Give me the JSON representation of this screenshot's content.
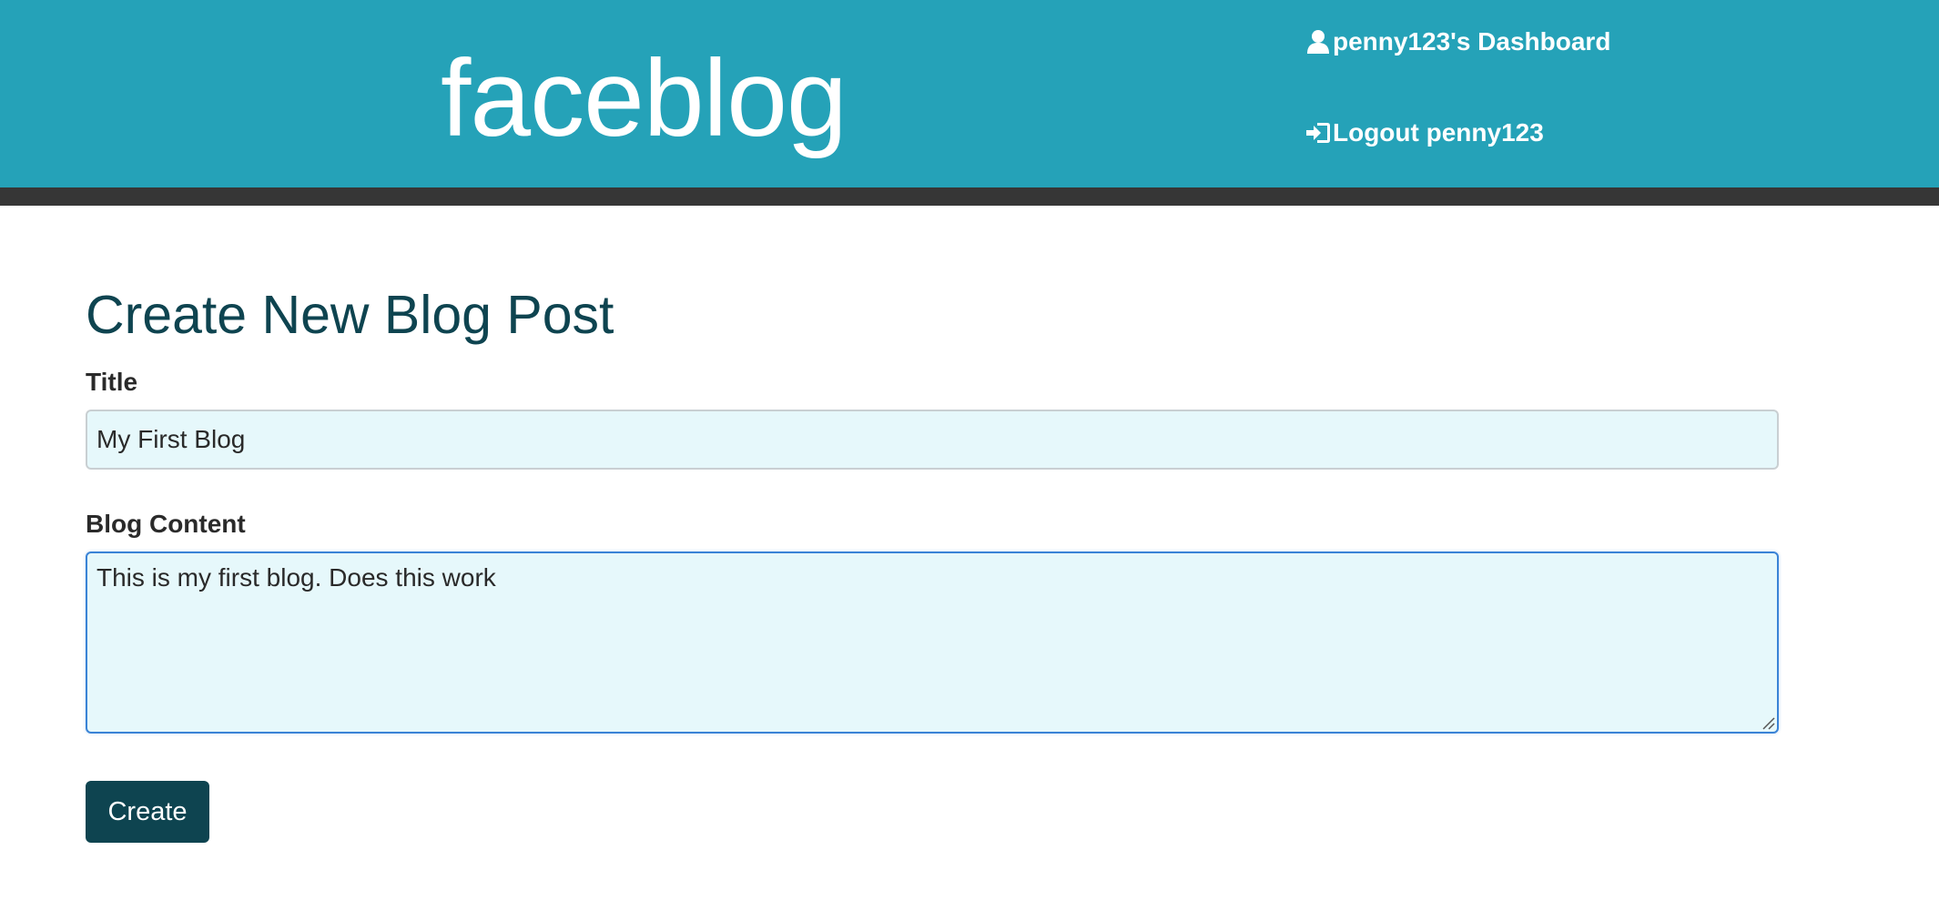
{
  "header": {
    "brand": "faceblog",
    "dashboard_link": "penny123's Dashboard",
    "logout_link": "Logout penny123",
    "colors": {
      "header_bg": "#25a2b8",
      "bar_bg": "#363636"
    },
    "icons": {
      "dashboard": "user-icon",
      "logout": "sign-in-icon"
    }
  },
  "form": {
    "heading": "Create New Blog Post",
    "title_label": "Title",
    "title_value": "My First Blog",
    "content_label": "Blog Content",
    "content_value": "This is my first blog. Does this work",
    "submit_label": "Create",
    "colors": {
      "accent": "#0e4450",
      "input_bg": "#e6f8fb",
      "focus_border": "#3a83d6"
    }
  }
}
